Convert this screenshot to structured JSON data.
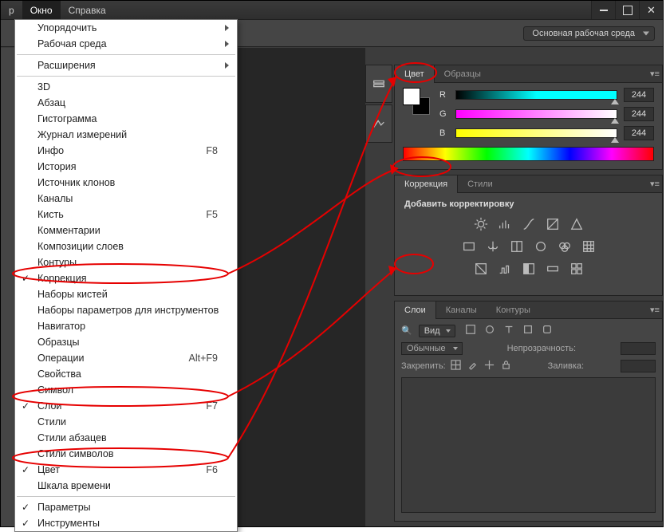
{
  "titlebar": {
    "menu_prefix": "р",
    "menu_window": "Окно",
    "menu_help": "Справка"
  },
  "optionsbar": {
    "workspace": "Основная рабочая среда"
  },
  "menu": {
    "arrange": "Упорядочить",
    "workspace": "Рабочая среда",
    "extensions": "Расширения",
    "i3d": "3D",
    "paragraph": "Абзац",
    "histogram": "Гистограмма",
    "measure_log": "Журнал измерений",
    "info": "Инфо",
    "info_sc": "F8",
    "history": "История",
    "clone_src": "Источник клонов",
    "channels": "Каналы",
    "brush": "Кисть",
    "brush_sc": "F5",
    "notes": "Комментарии",
    "layer_comps": "Композиции слоев",
    "paths": "Контуры",
    "adjustments": "Коррекция",
    "brush_presets": "Наборы кистей",
    "tool_presets": "Наборы параметров для инструментов",
    "navigator": "Навигатор",
    "swatches": "Образцы",
    "actions": "Операции",
    "actions_sc": "Alt+F9",
    "properties": "Свойства",
    "character": "Символ",
    "layers": "Слои",
    "layers_sc": "F7",
    "styles": "Стили",
    "para_styles": "Стили абзацев",
    "char_styles": "Стили символов",
    "color": "Цвет",
    "color_sc": "F6",
    "timeline": "Шкала времени",
    "options": "Параметры",
    "tools": "Инструменты"
  },
  "color_panel": {
    "tab_color": "Цвет",
    "tab_swatches": "Образцы",
    "r_label": "R",
    "r_val": "244",
    "g_label": "G",
    "g_val": "244",
    "b_label": "B",
    "b_val": "244"
  },
  "adj_panel": {
    "tab_adjust": "Коррекция",
    "tab_styles": "Стили",
    "add_adj": "Добавить корректировку"
  },
  "layers_panel": {
    "tab_layers": "Слои",
    "tab_channels": "Каналы",
    "tab_paths": "Контуры",
    "kind": "Вид",
    "blend": "Обычные",
    "opacity_label": "Непрозрачность:",
    "lock_label": "Закрепить:",
    "fill_label": "Заливка:"
  }
}
